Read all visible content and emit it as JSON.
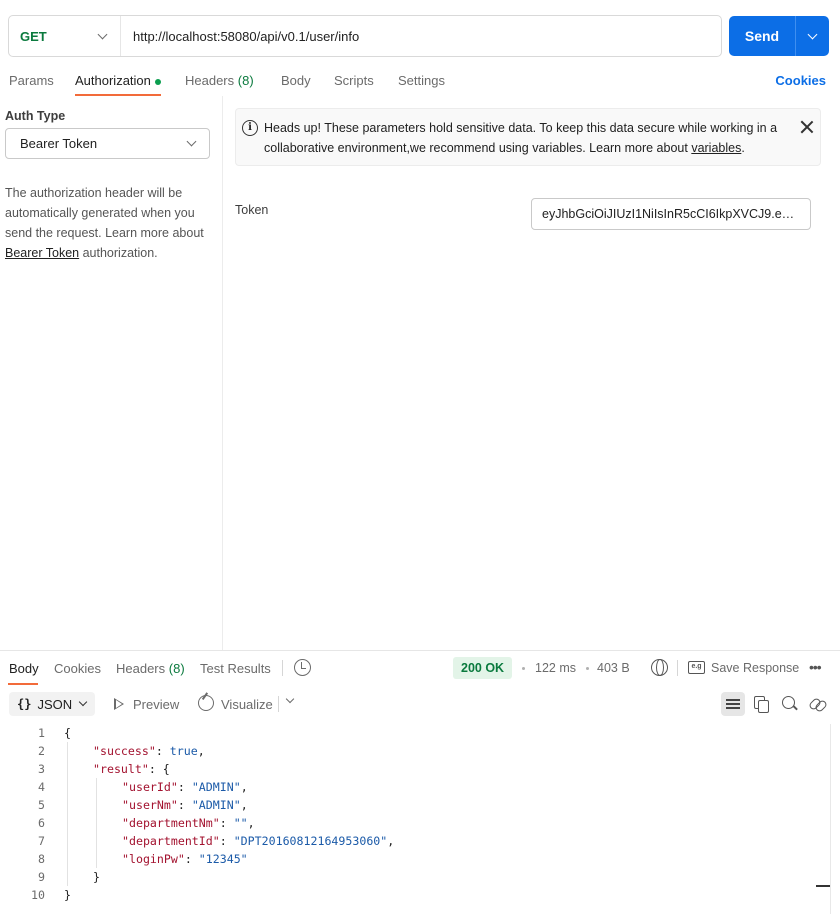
{
  "request": {
    "method": "GET",
    "url": "http://localhost:58080/api/v0.1/user/info",
    "send_label": "Send"
  },
  "request_tabs": {
    "params": "Params",
    "authorization": "Authorization",
    "headers": "Headers",
    "headers_count": "(8)",
    "body": "Body",
    "scripts": "Scripts",
    "settings": "Settings",
    "cookies": "Cookies"
  },
  "auth": {
    "type_label": "Auth Type",
    "type_value": "Bearer Token",
    "desc_prefix": "The authorization header will be automatically generated when you send the request. Learn more about ",
    "desc_link": "Bearer Token",
    "desc_suffix": " authorization.",
    "notice_prefix": "Heads up! These parameters hold sensitive data. To keep this data secure while working in a collaborative environment,we recommend using variables. Learn more about ",
    "notice_link": "variables",
    "notice_suffix": ".",
    "token_label": "Token",
    "token_value": "eyJhbGciOiJIUzI1NiIsInR5cCI6IkpXVCJ9.eyJ..."
  },
  "response_tabs": {
    "body": "Body",
    "cookies": "Cookies",
    "headers": "Headers",
    "headers_count": "(8)",
    "test_results": "Test Results"
  },
  "response_meta": {
    "status": "200 OK",
    "time": "122 ms",
    "size": "403 B",
    "save_label": "Save Response",
    "save_icon_text": "e.g"
  },
  "response_toolbar": {
    "format": "JSON",
    "format_icon": "{}",
    "preview": "Preview",
    "visualize": "Visualize"
  },
  "code_lines": [
    {
      "n": "1",
      "indent": 0,
      "tokens": [
        {
          "t": "{",
          "c": "p"
        }
      ]
    },
    {
      "n": "2",
      "indent": 1,
      "tokens": [
        {
          "t": "\"success\"",
          "c": "k"
        },
        {
          "t": ": ",
          "c": "p"
        },
        {
          "t": "true",
          "c": "b"
        },
        {
          "t": ",",
          "c": "p"
        }
      ]
    },
    {
      "n": "3",
      "indent": 1,
      "tokens": [
        {
          "t": "\"result\"",
          "c": "k"
        },
        {
          "t": ": {",
          "c": "p"
        }
      ]
    },
    {
      "n": "4",
      "indent": 2,
      "tokens": [
        {
          "t": "\"userId\"",
          "c": "k"
        },
        {
          "t": ": ",
          "c": "p"
        },
        {
          "t": "\"ADMIN\"",
          "c": "s"
        },
        {
          "t": ",",
          "c": "p"
        }
      ]
    },
    {
      "n": "5",
      "indent": 2,
      "tokens": [
        {
          "t": "\"userNm\"",
          "c": "k"
        },
        {
          "t": ": ",
          "c": "p"
        },
        {
          "t": "\"ADMIN\"",
          "c": "s"
        },
        {
          "t": ",",
          "c": "p"
        }
      ]
    },
    {
      "n": "6",
      "indent": 2,
      "tokens": [
        {
          "t": "\"departmentNm\"",
          "c": "k"
        },
        {
          "t": ": ",
          "c": "p"
        },
        {
          "t": "\"\"",
          "c": "s"
        },
        {
          "t": ",",
          "c": "p"
        }
      ]
    },
    {
      "n": "7",
      "indent": 2,
      "tokens": [
        {
          "t": "\"departmentId\"",
          "c": "k"
        },
        {
          "t": ": ",
          "c": "p"
        },
        {
          "t": "\"DPT20160812164953060\"",
          "c": "s"
        },
        {
          "t": ",",
          "c": "p"
        }
      ]
    },
    {
      "n": "8",
      "indent": 2,
      "tokens": [
        {
          "t": "\"loginPw\"",
          "c": "k"
        },
        {
          "t": ": ",
          "c": "p"
        },
        {
          "t": "\"12345\"",
          "c": "s"
        }
      ]
    },
    {
      "n": "9",
      "indent": 1,
      "tokens": [
        {
          "t": "}",
          "c": "p"
        }
      ]
    },
    {
      "n": "10",
      "indent": 0,
      "tokens": [
        {
          "t": "}",
          "c": "p"
        }
      ]
    }
  ],
  "colors": {
    "send_blue": "#0c6ee6",
    "method_green": "#0b7a3e",
    "active_tab_orange": "#f26b3a",
    "json_key": "#a3122f",
    "json_string": "#1b5aa8"
  }
}
